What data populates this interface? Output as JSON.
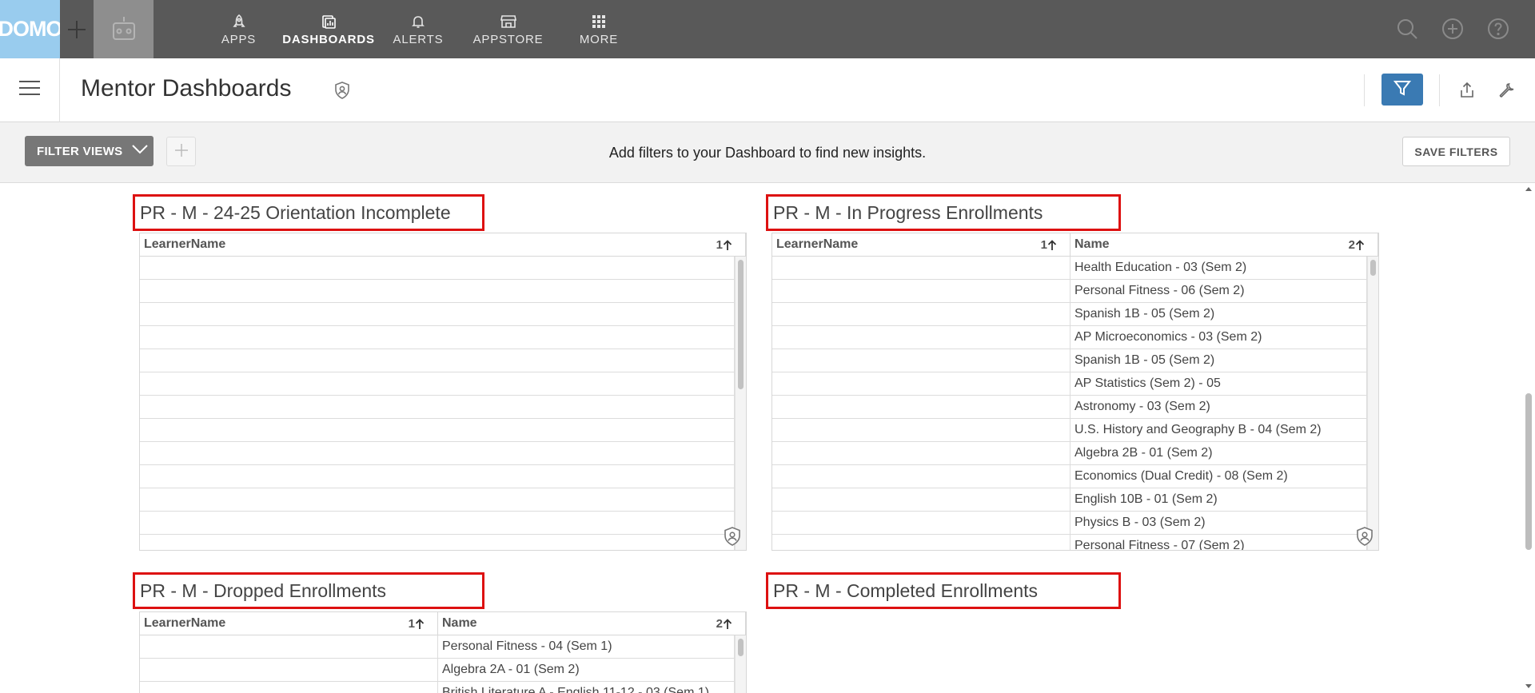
{
  "topbar": {
    "logo": "DOMO",
    "nav": [
      {
        "label": "APPS",
        "icon": "rocket-icon"
      },
      {
        "label": "DASHBOARDS",
        "icon": "dashboard-icon",
        "active": true
      },
      {
        "label": "ALERTS",
        "icon": "bell-icon"
      },
      {
        "label": "APPSTORE",
        "icon": "store-icon"
      },
      {
        "label": "MORE",
        "icon": "grid-icon"
      }
    ]
  },
  "header": {
    "title": "Mentor Dashboards",
    "accent": "#3a7ab3"
  },
  "filterbar": {
    "filter_views_label": "FILTER VIEWS",
    "message": "Add filters to your Dashboard to find new insights.",
    "save_filters_label": "SAVE FILTERS"
  },
  "cards": {
    "orientation": {
      "title": "PR - M - 24-25 Orientation Incomplete",
      "col1": "LearnerName",
      "col1_sort": "1"
    },
    "in_progress": {
      "title": "PR - M - In Progress Enrollments",
      "col1": "LearnerName",
      "col1_sort": "1",
      "col2": "Name",
      "col2_sort": "2",
      "rows": [
        "Health Education - 03 (Sem 2)",
        "Personal Fitness - 06 (Sem 2)",
        "Spanish 1B - 05 (Sem 2)",
        "AP Microeconomics - 03 (Sem 2)",
        "Spanish 1B - 05 (Sem 2)",
        "AP Statistics (Sem 2) - 05",
        "Astronomy - 03 (Sem 2)",
        "U.S. History and Geography B - 04 (Sem 2)",
        "Algebra 2B - 01 (Sem 2)",
        "Economics (Dual Credit) - 08 (Sem 2)",
        "English 10B - 01 (Sem 2)",
        "Physics B - 03 (Sem 2)",
        "Personal Fitness - 07 (Sem 2)"
      ]
    },
    "dropped": {
      "title": "PR - M - Dropped Enrollments",
      "col1": "LearnerName",
      "col1_sort": "1",
      "col2": "Name",
      "col2_sort": "2",
      "rows": [
        "Personal Fitness - 04 (Sem 1)",
        "Algebra 2A - 01 (Sem 2)",
        "British Literature A - English 11-12 - 03 (Sem 1)"
      ]
    },
    "completed": {
      "title": "PR - M - Completed Enrollments"
    }
  },
  "colors": {
    "topbar_bg": "#595959",
    "highlight_border": "#dd1111"
  }
}
